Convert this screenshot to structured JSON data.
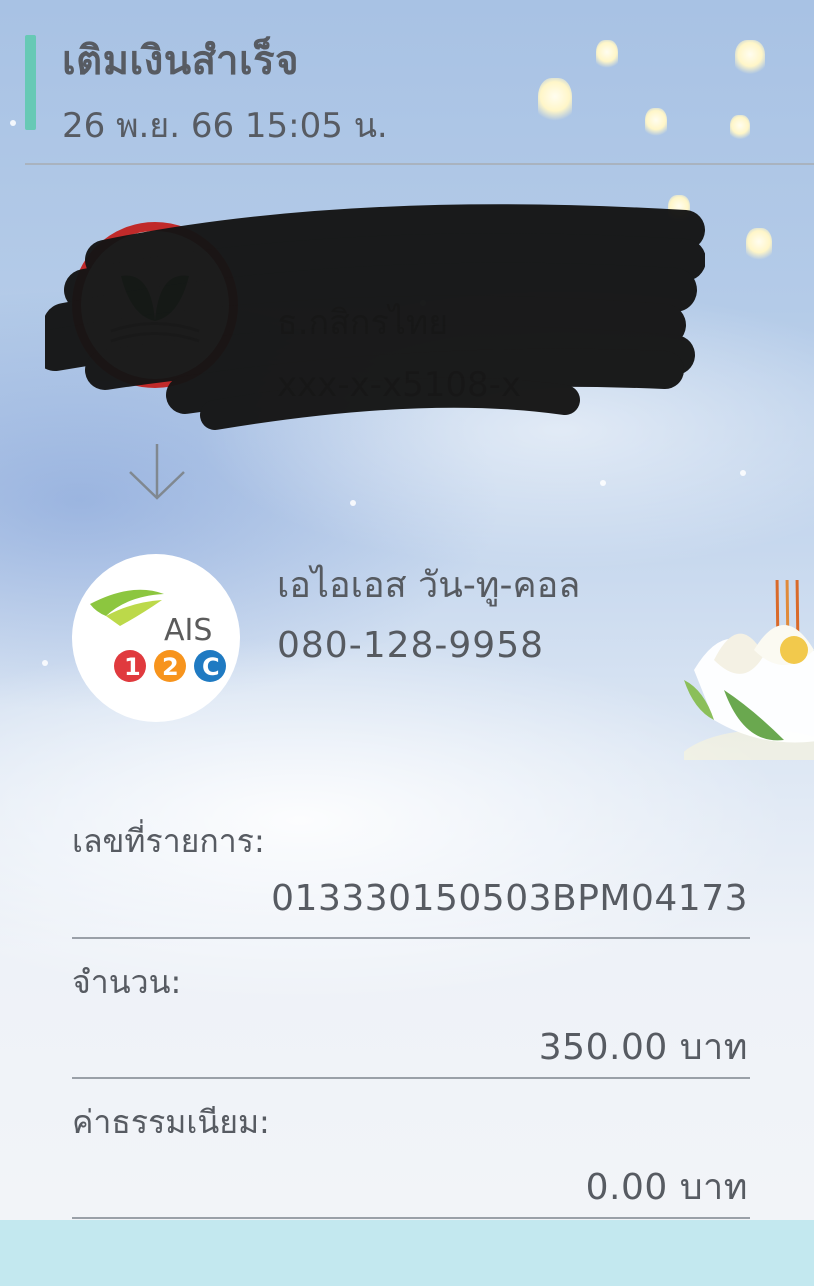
{
  "header": {
    "title": "เติมเงินสำเร็จ",
    "datetime": "26 พ.ย. 66  15:05 น."
  },
  "from_account": {
    "bank_name": "ธ.กสิกรไทย",
    "account_number": "xxx-x-x5108-x",
    "redacted": true
  },
  "to_account": {
    "name": "เอไอเอส วัน-ทู-คอล",
    "number": "080-128-9958",
    "logo_text": "AIS",
    "logo_digits": [
      "1",
      "2",
      "C"
    ]
  },
  "details": [
    {
      "label": "เลขที่รายการ:",
      "value": "013330150503BPM04173"
    },
    {
      "label": "จำนวน:",
      "value": "350.00 บาท"
    },
    {
      "label": "ค่าธรรมเนียม:",
      "value": "0.00 บาท"
    }
  ],
  "colors": {
    "accent": "#67c9b5",
    "bank_ring": "#c02a2a",
    "ais_green": "#8cc63f",
    "ais_red": "#e03a3e",
    "ais_orange": "#f7941d",
    "ais_blue": "#1f7ac2"
  }
}
